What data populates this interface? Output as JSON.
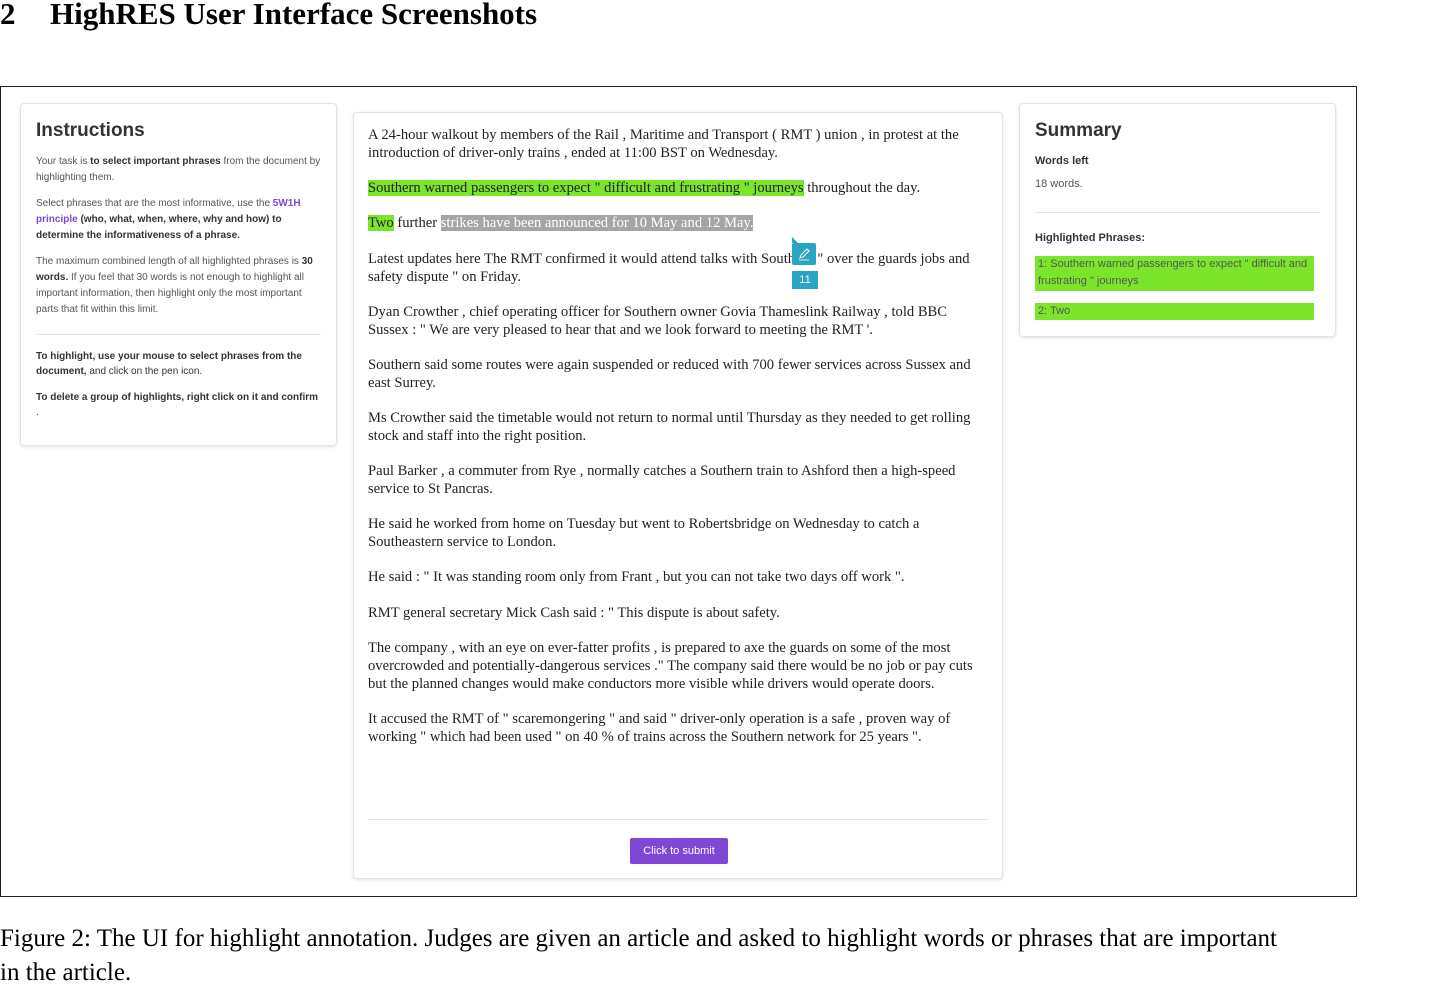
{
  "section": {
    "number": "2",
    "title": "HighRES User Interface Screenshots"
  },
  "instructions": {
    "title": "Instructions",
    "p1_a": "Your task is ",
    "p1_b": "to select important phrases",
    "p1_c": " from the document by highlighting them.",
    "p2_a": "Select phrases that are the most informative, use the ",
    "p2_link": "5W1H principle",
    "p2_b": " (who, what, when, where, why and how) to determine the informativeness of a phrase.",
    "p3_a": "The maximum combined length of all highlighted phrases is ",
    "p3_b": "30 words.",
    "p3_c": " If you feel that 30 words is not enough to highlight all important information, then highlight only the most important parts that fit within this limit.",
    "p4_a": "To highlight, use your mouse to select phrases from the document,",
    "p4_b": " and click on the pen icon.",
    "p5_a": "To delete a group of highlights, right click on it and confirm",
    "p5_b": " ."
  },
  "summary": {
    "title": "Summary",
    "words_left_label": "Words left",
    "words_left_value": "18 words.",
    "highlighted_label": "Highlighted Phrases:",
    "items": [
      "1: Southern warned passengers to expect \" difficult and frustrating \" journeys",
      "2: Two"
    ]
  },
  "article": {
    "p1": "A 24-hour walkout by members of the Rail , Maritime and Transport ( RMT ) union , in protest at the introduction of driver-only trains , ended at 11:00 BST on Wednesday.",
    "p2_hl": "Southern warned passengers to expect \" difficult and frustrating \" journeys",
    "p2_rest": " throughout the day.",
    "p3_hl": "Two",
    "p3_mid": " further ",
    "p3_sel": "strikes have been announced for 10 May and 12 May.",
    "p4": "Latest updates here The RMT confirmed it would attend talks with Southern \" over the guards jobs and safety dispute \" on Friday.",
    "p5": "Dyan Crowther , chief operating officer for Southern owner Govia Thameslink Railway , told BBC Sussex : \" We are very pleased to hear that and we look forward to meeting the RMT '.",
    "p6": "Southern said some routes were again suspended or reduced with 700 fewer services across Sussex and east Surrey.",
    "p7": "Ms Crowther said the timetable would not return to normal until Thursday as they needed to get rolling stock and staff into the right position.",
    "p8": "Paul Barker , a commuter from Rye , normally catches a Southern train to Ashford then a high-speed service to St Pancras.",
    "p9": "He said he worked from home on Tuesday but went to Robertsbridge on Wednesday to catch a Southeastern service to London.",
    "p10": "He said : \" It was standing room only from Frant , but you can not take two days off work \".",
    "p11": "RMT general secretary Mick Cash said : \" This dispute is about safety.",
    "p12": "The company , with an eye on ever-fatter profits , is prepared to axe the guards on some of the most overcrowded and potentially-dangerous services .\" The company said there would be no job or pay cuts but the planned changes would make conductors more visible while drivers would operate doors.",
    "p13": "It accused the RMT of \" scaremongering \" and said \" driver-only operation is a safe , proven way of working \" which had been used \" on 40 % of trains across the Southern network for 25 years \".",
    "selection_count": "11",
    "submit_label": "Click to submit"
  },
  "caption": "Figure 2: The UI for highlight annotation. Judges are given an article and asked to highlight words or phrases that are important in the article.",
  "colors": {
    "highlight_green": "#7be52c",
    "selection_grey": "#a5a5a5",
    "accent_purple": "#7e47d6",
    "pen_blue": "#2aa4c4"
  },
  "icons": {
    "pen": "pen-icon"
  }
}
